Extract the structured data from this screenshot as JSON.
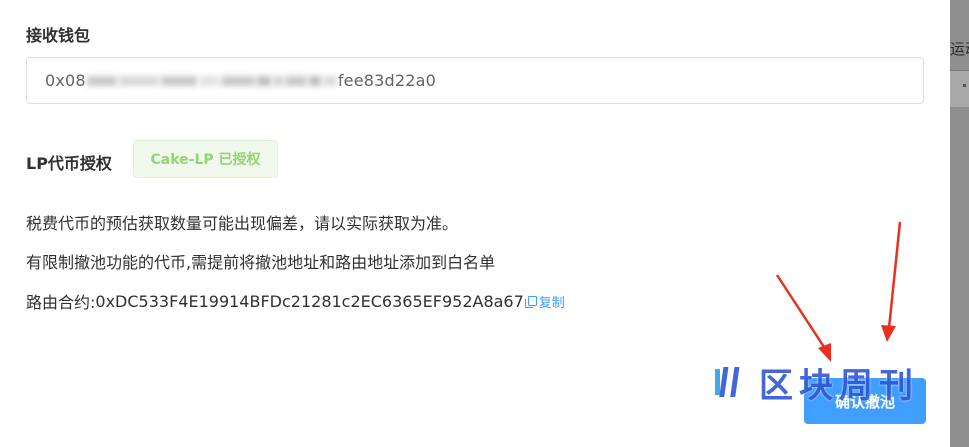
{
  "backdrop": {
    "partial_text": "运动"
  },
  "form": {
    "wallet_label": "接收钱包",
    "wallet_value_prefix": "0x08",
    "wallet_value_suffix": "fee83d22a0",
    "lp_label": "LP代币授权",
    "lp_status": "Cake-LP 已授权"
  },
  "notes": {
    "line1": "税费代币的预估获取数量可能出现偏差，请以实际获取为准。",
    "line2": "有限制撤池功能的代币,需提前将撤池地址和路由地址添加到白名单",
    "router_label": "路由合约:",
    "router_address": "0xDC533F4E19914BFDc21281c2EC6365EF952A8a67",
    "copy_label": "复制"
  },
  "actions": {
    "confirm_label": "确认撤池"
  },
  "watermark": {
    "text": "区块周刊"
  },
  "colors": {
    "primary": "#409eff",
    "success_text": "#95d475",
    "arrow": "#e8301f"
  }
}
